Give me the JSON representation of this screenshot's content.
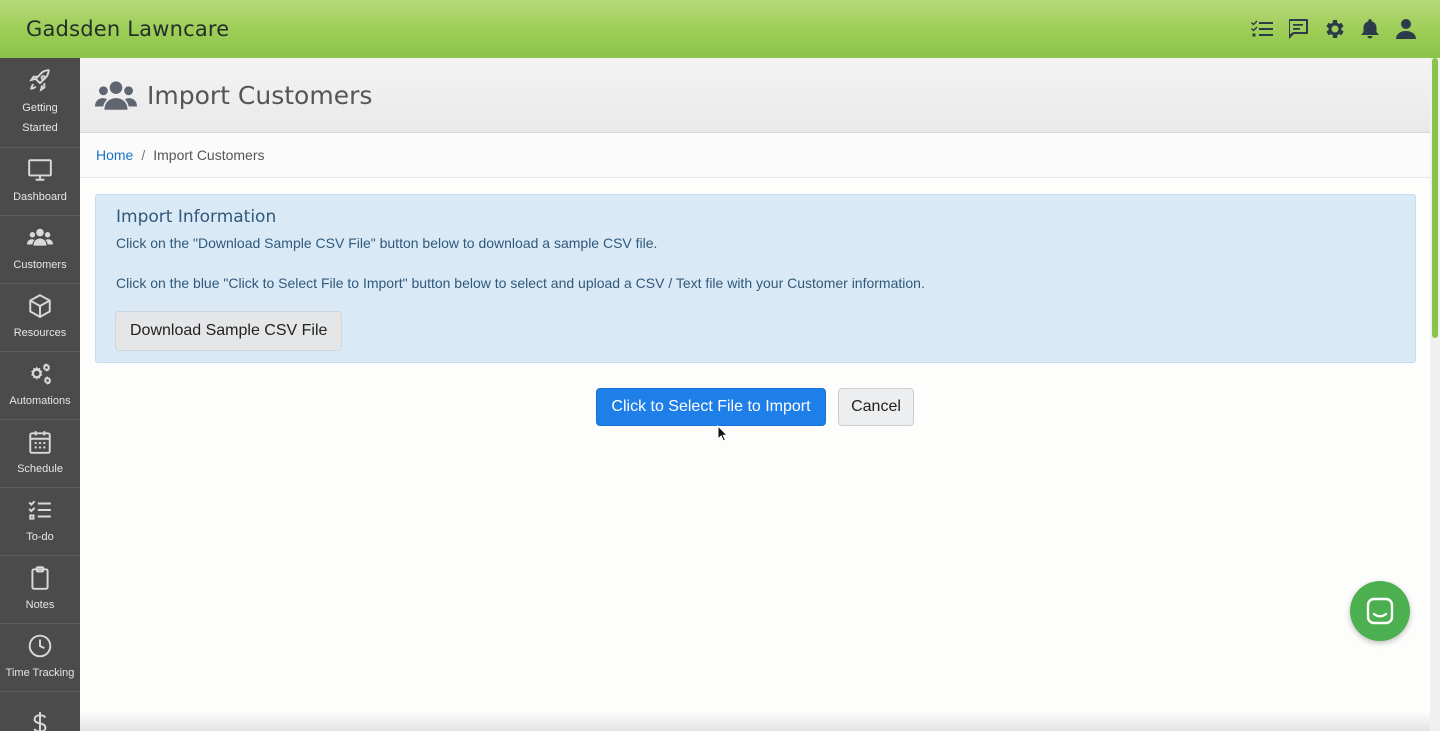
{
  "app": {
    "brand": "Gadsden Lawncare"
  },
  "topbar": {
    "icons": [
      "tasks-icon",
      "message-icon",
      "gear-icon",
      "bell-icon",
      "user-icon"
    ]
  },
  "sidebar": {
    "items": [
      {
        "label_line1": "Getting",
        "label_line2": "Started",
        "icon": "rocket-icon"
      },
      {
        "label": "Dashboard",
        "icon": "monitor-icon"
      },
      {
        "label": "Customers",
        "icon": "users-icon"
      },
      {
        "label": "Resources",
        "icon": "box-icon"
      },
      {
        "label": "Automations",
        "icon": "gears-icon"
      },
      {
        "label": "Schedule",
        "icon": "calendar-icon"
      },
      {
        "label": "To-do",
        "icon": "checklist-icon"
      },
      {
        "label": "Notes",
        "icon": "clipboard-icon"
      },
      {
        "label": "Time Tracking",
        "icon": "clock-icon"
      },
      {
        "label": "",
        "icon": "dollar-icon"
      }
    ]
  },
  "page": {
    "title": "Import Customers"
  },
  "breadcrumb": {
    "home": "Home",
    "separator": "/",
    "current": "Import Customers"
  },
  "info": {
    "title": "Import Information",
    "line1": "Click on the \"Download Sample CSV File\" button below to download a sample CSV file.",
    "line2": "Click on the blue \"Click to Select File to Import\" button below to select and upload a CSV / Text file with your Customer information.",
    "download_label": "Download Sample CSV File"
  },
  "actions": {
    "select_label": "Click to Select File to Import",
    "cancel_label": "Cancel"
  },
  "colors": {
    "topbar": "#8bc34a",
    "sidebar": "#4b4b4b",
    "primary": "#1f7fe8",
    "info_bg": "#d9eaf6",
    "chat": "#4caf50"
  }
}
